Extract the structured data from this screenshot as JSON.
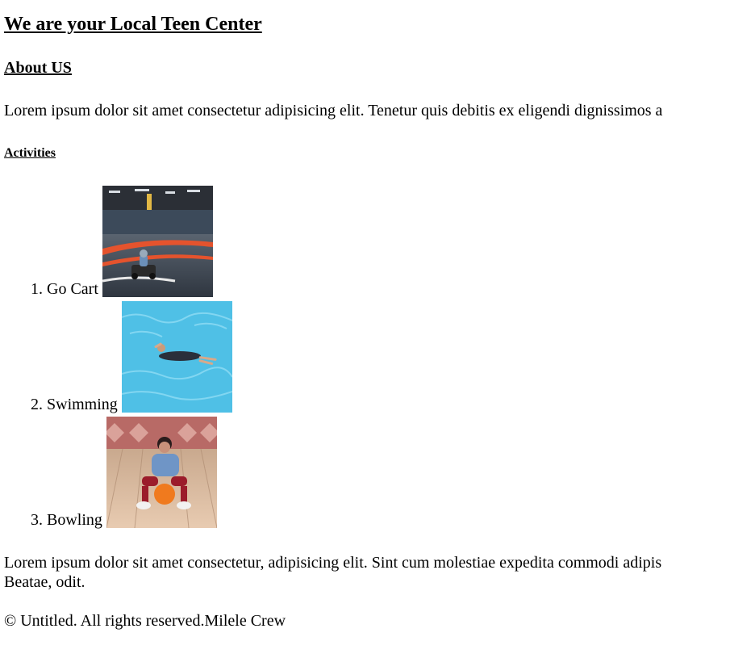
{
  "header": {
    "title": "We are your Local Teen Center"
  },
  "about": {
    "heading": "About US",
    "text": "Lorem ipsum dolor sit amet consectetur adipisicing elit. Tenetur quis debitis ex eligendi dignissimos a"
  },
  "activities": {
    "heading": "Activities",
    "items": [
      {
        "number": "1.",
        "label": "Go Cart",
        "image": "go-cart-photo"
      },
      {
        "number": "2.",
        "label": "Swimming",
        "image": "swimming-photo"
      },
      {
        "number": "3.",
        "label": "Bowling",
        "image": "bowling-photo"
      }
    ]
  },
  "closing": {
    "line1": "Lorem ipsum dolor sit amet consectetur, adipisicing elit. Sint cum molestiae expedita commodi adipis",
    "line2": "Beatae, odit."
  },
  "footer": {
    "text": "© Untitled. All rights reserved.Milele Crew"
  }
}
